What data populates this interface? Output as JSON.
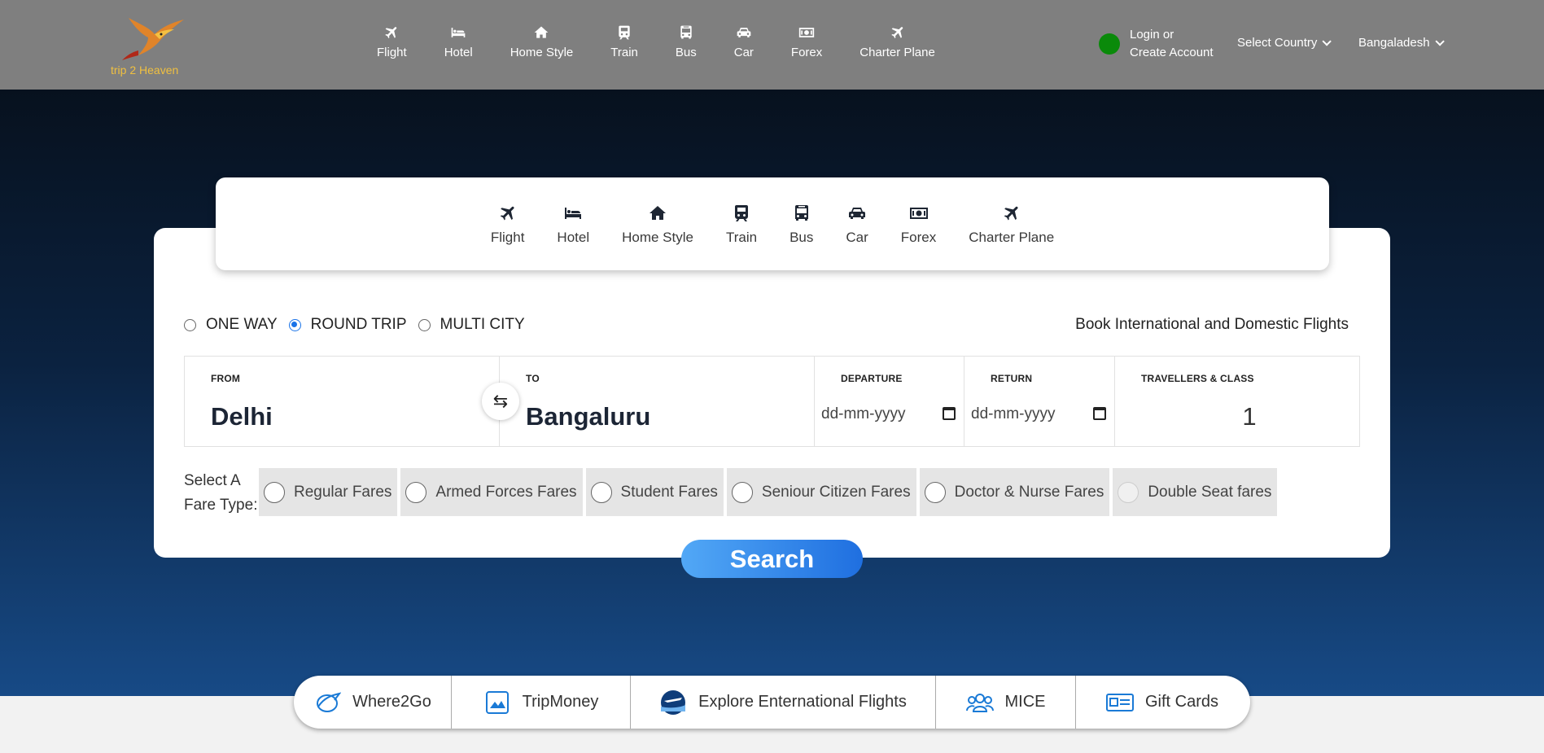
{
  "logo": {
    "text": "trip 2 Heaven"
  },
  "topnav": [
    {
      "label": "Flight",
      "icon": "plane-icon"
    },
    {
      "label": "Hotel",
      "icon": "bed-icon"
    },
    {
      "label": "Home Style",
      "icon": "home-icon"
    },
    {
      "label": "Train",
      "icon": "train-icon"
    },
    {
      "label": "Bus",
      "icon": "bus-icon"
    },
    {
      "label": "Car",
      "icon": "car-icon"
    },
    {
      "label": "Forex",
      "icon": "money-icon"
    },
    {
      "label": "Charter Plane",
      "icon": "plane-icon"
    }
  ],
  "account": {
    "line1": "Login or",
    "line2": "Create Account",
    "status_color": "#0a8a0a"
  },
  "country_select": {
    "label": "Select Country"
  },
  "country_current": {
    "label": "Bangaladesh"
  },
  "tabs": [
    {
      "label": "Flight",
      "icon": "plane-icon"
    },
    {
      "label": "Hotel",
      "icon": "bed-icon"
    },
    {
      "label": "Home Style",
      "icon": "home-icon"
    },
    {
      "label": "Train",
      "icon": "train-icon"
    },
    {
      "label": "Bus",
      "icon": "bus-icon"
    },
    {
      "label": "Car",
      "icon": "car-icon"
    },
    {
      "label": "Forex",
      "icon": "money-icon"
    },
    {
      "label": "Charter Plane",
      "icon": "plane-icon"
    }
  ],
  "trip_types": [
    {
      "label": "ONE WAY",
      "selected": false
    },
    {
      "label": "ROUND TRIP",
      "selected": true
    },
    {
      "label": "MULTI CITY",
      "selected": false
    }
  ],
  "tagline": "Book International and Domestic Flights",
  "search": {
    "from_label": "FROM",
    "from_value": "Delhi",
    "to_label": "TO",
    "to_value": "Bangaluru",
    "departure_label": "DEPARTURE",
    "departure_placeholder": "dd-mm-yyyy",
    "return_label": "RETURN",
    "return_placeholder": "dd-mm-yyyy",
    "travellers_label": "TRAVELLERS & CLASS",
    "travellers_value": "1",
    "swap_icon": "swap-arrows-icon"
  },
  "fare_type": {
    "label_line1": "Select A",
    "label_line2": "Fare Type:",
    "options": [
      {
        "label": "Regular Fares",
        "disabled": false
      },
      {
        "label": "Armed Forces Fares",
        "disabled": false
      },
      {
        "label": "Student Fares",
        "disabled": false
      },
      {
        "label": "Seniour Citizen Fares",
        "disabled": false
      },
      {
        "label": "Doctor & Nurse Fares",
        "disabled": false
      },
      {
        "label": "Double Seat fares",
        "disabled": true
      }
    ]
  },
  "search_button": "Search",
  "quick_links": [
    {
      "label": "Where2Go",
      "icon": "globe-plane-icon"
    },
    {
      "label": "TripMoney",
      "icon": "picture-icon"
    },
    {
      "label": "Explore Enternational Flights",
      "icon": "airplane-photo-icon"
    },
    {
      "label": "MICE",
      "icon": "group-icon"
    },
    {
      "label": "Gift Cards",
      "icon": "gift-card-icon"
    }
  ],
  "colors": {
    "accent": "#1a73e8",
    "nav_bg": "#7f7f7f",
    "logo_text": "#f0c040"
  }
}
